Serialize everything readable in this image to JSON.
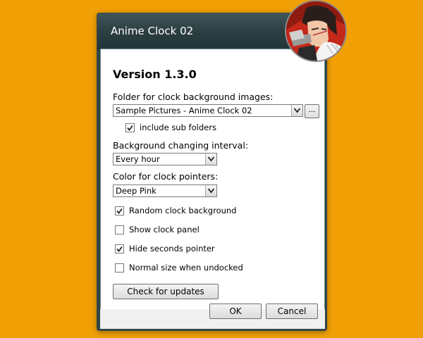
{
  "window": {
    "title": "Anime Clock 02"
  },
  "dialog": {
    "version": "Version 1.3.0",
    "folder": {
      "label": "Folder for clock background images:",
      "value": "Sample Pictures - Anime Clock 02",
      "browse_label": "..."
    },
    "include_subfolders": {
      "label": "include sub folders",
      "checked": true
    },
    "interval": {
      "label": "Background changing interval:",
      "value": "Every hour"
    },
    "pointer_color": {
      "label": "Color for clock pointers:",
      "value": "Deep Pink"
    },
    "options": [
      {
        "label": "Random clock background",
        "checked": true
      },
      {
        "label": "Show clock panel",
        "checked": false
      },
      {
        "label": "Hide seconds pointer",
        "checked": true
      },
      {
        "label": "Normal size when undocked",
        "checked": false
      }
    ],
    "check_updates_label": "Check for updates",
    "ok_label": "OK",
    "cancel_label": "Cancel"
  },
  "colors": {
    "desktop": "#f0a004",
    "titlebar": "#2f4447"
  },
  "icons": {
    "gadget_avatar": "anime-character-avatar"
  }
}
